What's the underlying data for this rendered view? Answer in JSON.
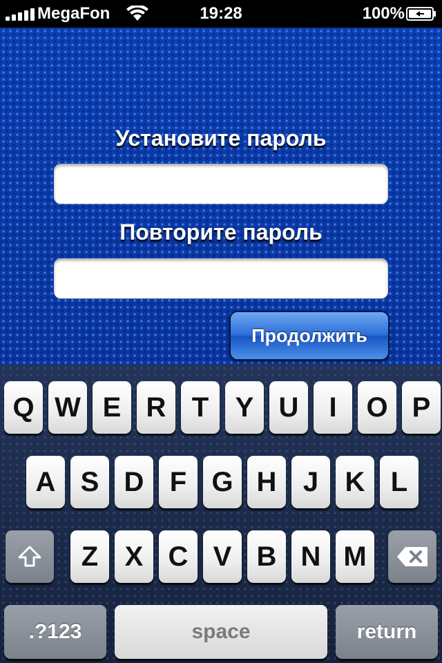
{
  "status_bar": {
    "carrier": "MegaFon",
    "time": "19:28",
    "battery_percent": "100%"
  },
  "form": {
    "password_label": "Установите пароль",
    "password_value": "",
    "repeat_label": "Повторите пароль",
    "repeat_value": "",
    "continue_label": "Продолжить"
  },
  "keyboard": {
    "row1": [
      "Q",
      "W",
      "E",
      "R",
      "T",
      "Y",
      "U",
      "I",
      "O",
      "P"
    ],
    "row2": [
      "A",
      "S",
      "D",
      "F",
      "G",
      "H",
      "J",
      "K",
      "L"
    ],
    "row3": [
      "Z",
      "X",
      "C",
      "V",
      "B",
      "N",
      "M"
    ],
    "numbers_label": ".?123",
    "space_label": "space",
    "return_label": "return",
    "shift_icon": "shift-icon",
    "backspace_icon": "backspace-icon"
  },
  "colors": {
    "background_blue": "#0b3aa6",
    "button_blue": "#2d6fd8",
    "keyboard_bg": "#1b2a4a"
  }
}
